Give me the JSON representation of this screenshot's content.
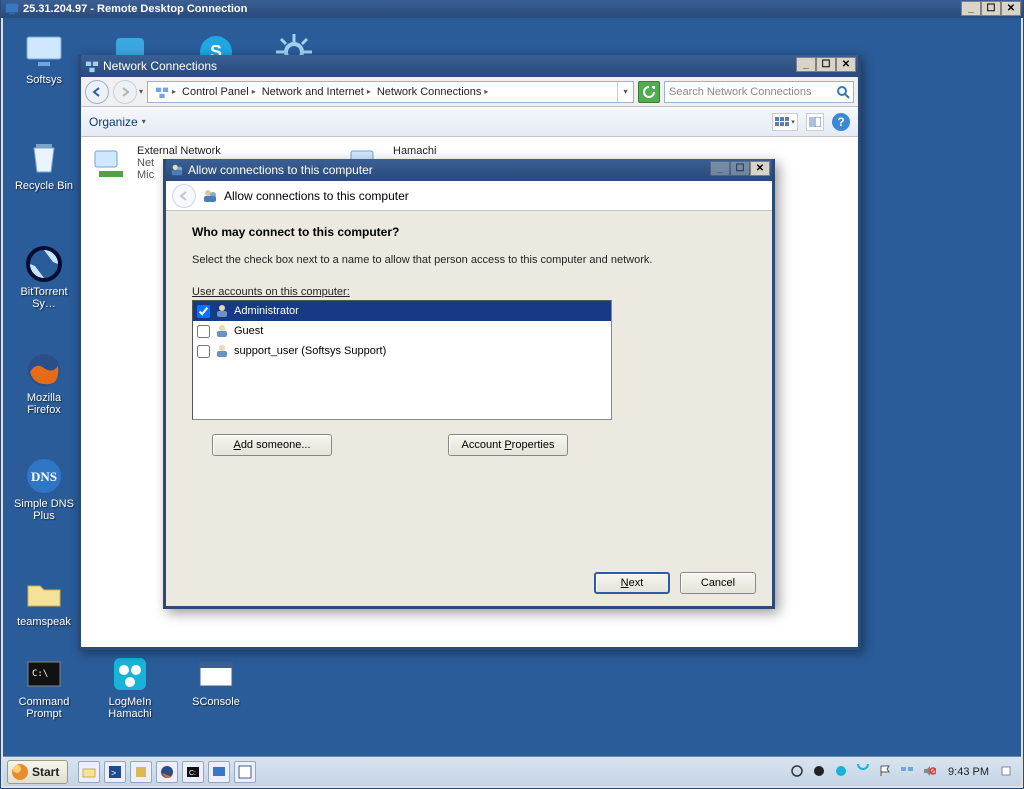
{
  "rdp": {
    "title": "25.31.204.97 - Remote Desktop Connection"
  },
  "desktop_icons": [
    {
      "label": "Softsys",
      "key": "softsys"
    },
    {
      "label": "Recycle Bin",
      "key": "recycle-bin"
    },
    {
      "label": "BitTorrent Sy…",
      "key": "bittorrent-sync"
    },
    {
      "label": "Mozilla Firefox",
      "key": "firefox"
    },
    {
      "label": "Simple DNS Plus",
      "key": "simple-dns-plus"
    },
    {
      "label": "teamspeak",
      "key": "teamspeak"
    },
    {
      "label": "Command Prompt",
      "key": "command-prompt"
    },
    {
      "label": "LogMeIn Hamachi",
      "key": "logmein-hamachi"
    },
    {
      "label": "SConsole",
      "key": "sconsole"
    }
  ],
  "taskbar": {
    "start": "Start",
    "clock": "9:43 PM"
  },
  "nc_window": {
    "title": "Network Connections",
    "crumbs": [
      "Control Panel",
      "Network and Internet",
      "Network Connections"
    ],
    "search_placeholder": "Search Network Connections",
    "organize": "Organize",
    "items": [
      {
        "title": "External Network",
        "line2": "Net",
        "line3": "Mic"
      },
      {
        "title": "Hamachi",
        "line2": "",
        "line3": ""
      }
    ]
  },
  "wizard": {
    "title": "Allow connections to this computer",
    "banner_title": "Allow connections to this computer",
    "heading": "Who may connect to this computer?",
    "text": "Select the check box next to a name to allow that person access to this computer and network.",
    "list_label": "User accounts on this computer:",
    "users": [
      {
        "name": "Administrator",
        "checked": true,
        "selected": true
      },
      {
        "name": "Guest",
        "checked": false,
        "selected": false
      },
      {
        "name": "support_user (Softsys Support)",
        "checked": false,
        "selected": false
      }
    ],
    "add_btn": "Add someone...",
    "props_btn": "Account Properties",
    "next": "Next",
    "cancel": "Cancel"
  }
}
